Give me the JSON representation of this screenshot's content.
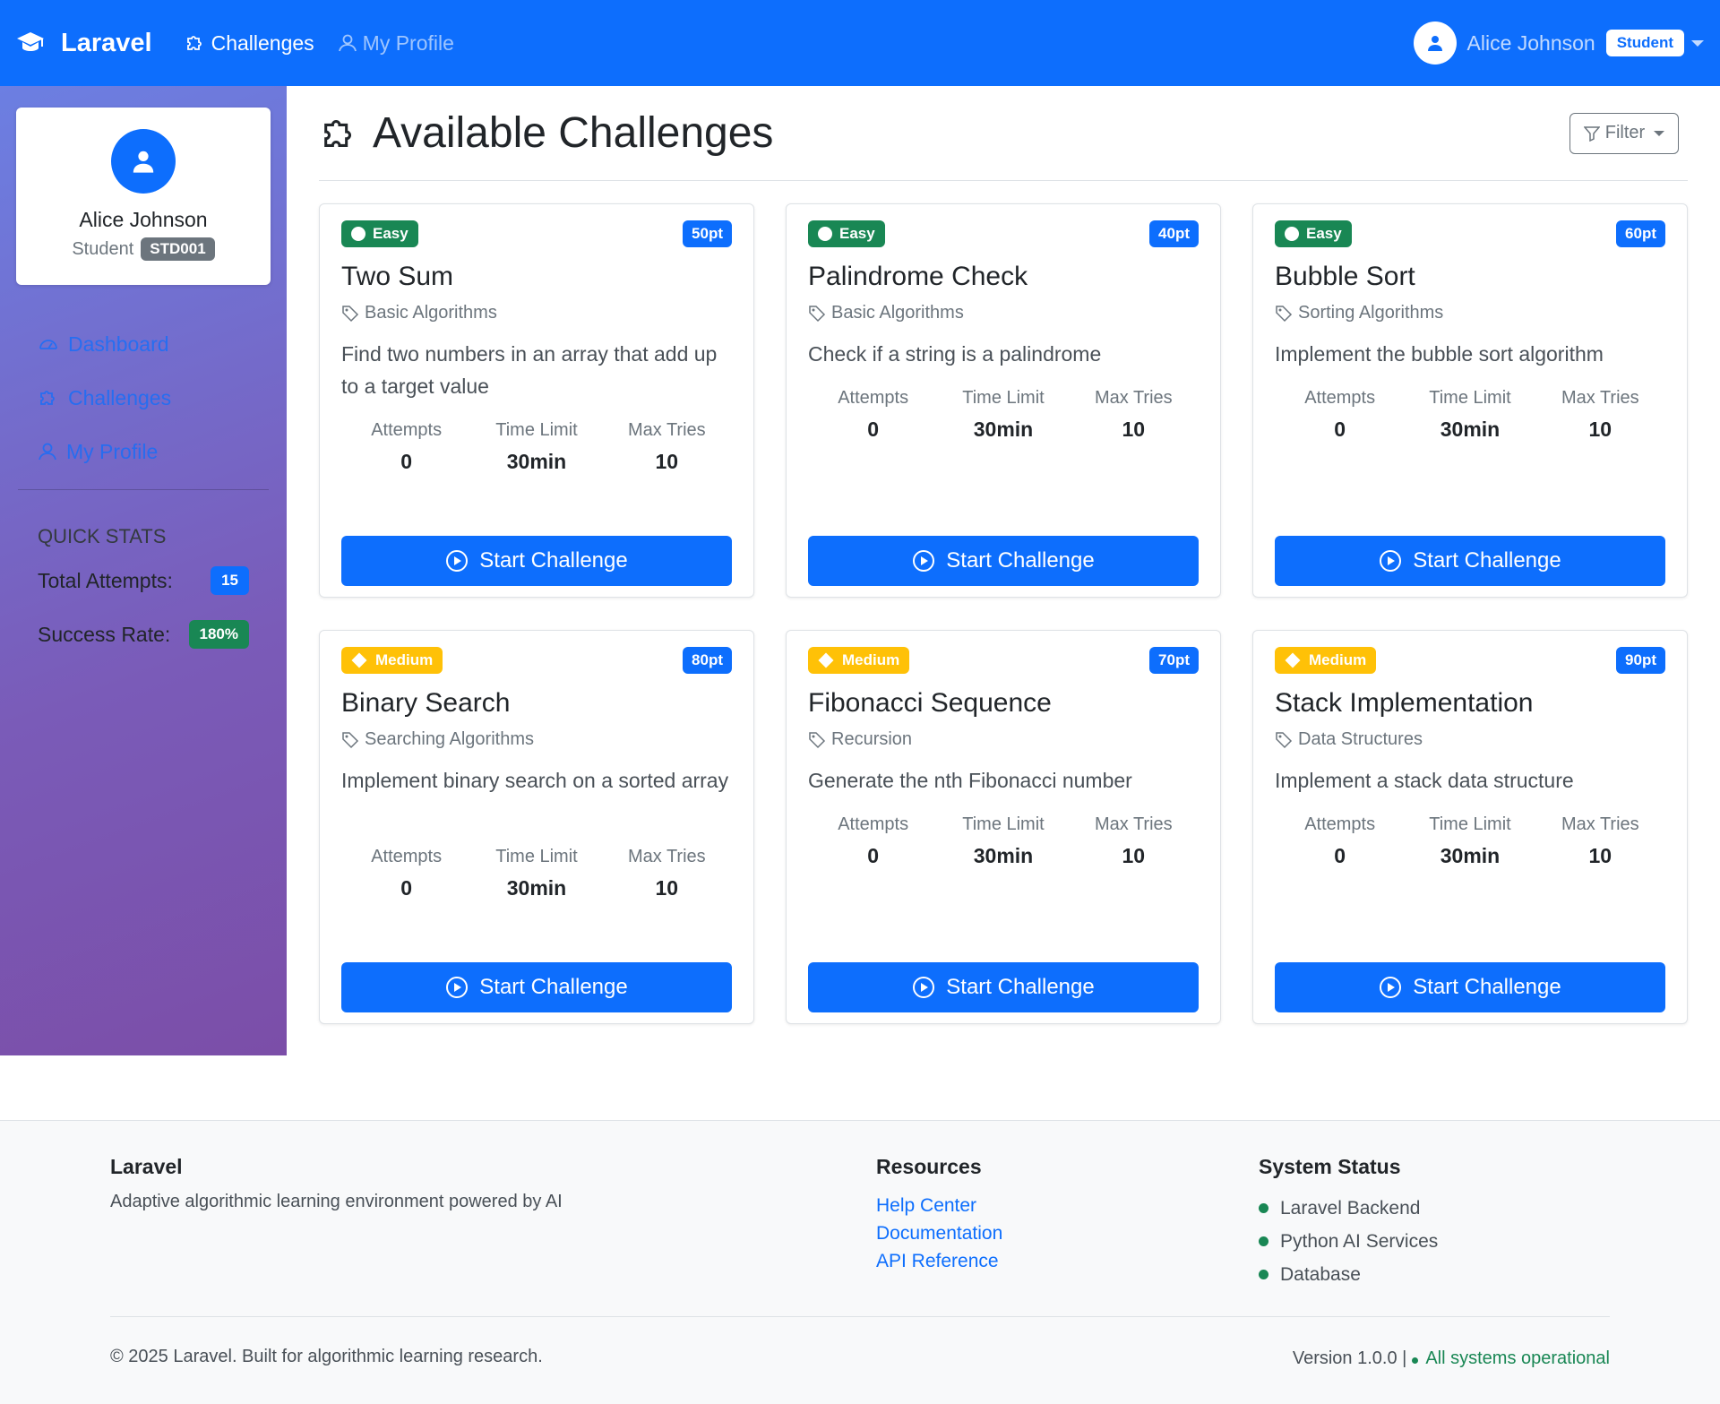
{
  "navbar": {
    "brand": "Laravel",
    "links": [
      {
        "label": "Challenges",
        "icon": "puzzle-icon",
        "active": true
      },
      {
        "label": "My Profile",
        "icon": "person-icon",
        "active": false
      }
    ],
    "user_name": "Alice Johnson",
    "role_badge": "Student"
  },
  "sidebar": {
    "profile": {
      "name": "Alice Johnson",
      "role": "Student",
      "student_id": "STD001"
    },
    "nav": [
      {
        "label": "Dashboard",
        "icon": "speedometer-icon"
      },
      {
        "label": "Challenges",
        "icon": "puzzle-icon"
      },
      {
        "label": "My Profile",
        "icon": "person-icon"
      }
    ],
    "quick_stats": {
      "title": "Quick Stats",
      "total_attempts_label": "Total Attempts:",
      "total_attempts_value": "15",
      "success_rate_label": "Success Rate:",
      "success_rate_value": "180%"
    }
  },
  "main": {
    "title": "Available Challenges",
    "filter_label": "Filter",
    "start_label": "Start Challenge",
    "stat_labels": {
      "attempts": "Attempts",
      "time_limit": "Time Limit",
      "max_tries": "Max Tries"
    },
    "challenges": [
      {
        "difficulty": "Easy",
        "points": "50pt",
        "title": "Two Sum",
        "category": "Basic Algorithms",
        "description": "Find two numbers in an array that add up to a target value",
        "attempts": "0",
        "time_limit": "30min",
        "max_tries": "10"
      },
      {
        "difficulty": "Easy",
        "points": "40pt",
        "title": "Palindrome Check",
        "category": "Basic Algorithms",
        "description": "Check if a string is a palindrome",
        "attempts": "0",
        "time_limit": "30min",
        "max_tries": "10"
      },
      {
        "difficulty": "Easy",
        "points": "60pt",
        "title": "Bubble Sort",
        "category": "Sorting Algorithms",
        "description": "Implement the bubble sort algorithm",
        "attempts": "0",
        "time_limit": "30min",
        "max_tries": "10"
      },
      {
        "difficulty": "Medium",
        "points": "80pt",
        "title": "Binary Search",
        "category": "Searching Algorithms",
        "description": "Implement binary search on a sorted array",
        "attempts": "0",
        "time_limit": "30min",
        "max_tries": "10"
      },
      {
        "difficulty": "Medium",
        "points": "70pt",
        "title": "Fibonacci Sequence",
        "category": "Recursion",
        "description": "Generate the nth Fibonacci number",
        "attempts": "0",
        "time_limit": "30min",
        "max_tries": "10"
      },
      {
        "difficulty": "Medium",
        "points": "90pt",
        "title": "Stack Implementation",
        "category": "Data Structures",
        "description": "Implement a stack data structure",
        "attempts": "0",
        "time_limit": "30min",
        "max_tries": "10"
      }
    ]
  },
  "footer": {
    "brand": "Laravel",
    "tagline": "Adaptive algorithmic learning environment powered by AI",
    "resources_title": "Resources",
    "resources": [
      "Help Center",
      "Documentation",
      "API Reference"
    ],
    "status_title": "System Status",
    "statuses": [
      "Laravel Backend",
      "Python AI Services",
      "Database"
    ],
    "copyright": "© 2025 Laravel. Built for algorithmic learning research.",
    "version": "Version 1.0.0 |",
    "operational": "All systems operational"
  },
  "colors": {
    "primary": "#0d6efd",
    "success": "#198754",
    "warning": "#ffc107",
    "secondary": "#6c757d"
  }
}
